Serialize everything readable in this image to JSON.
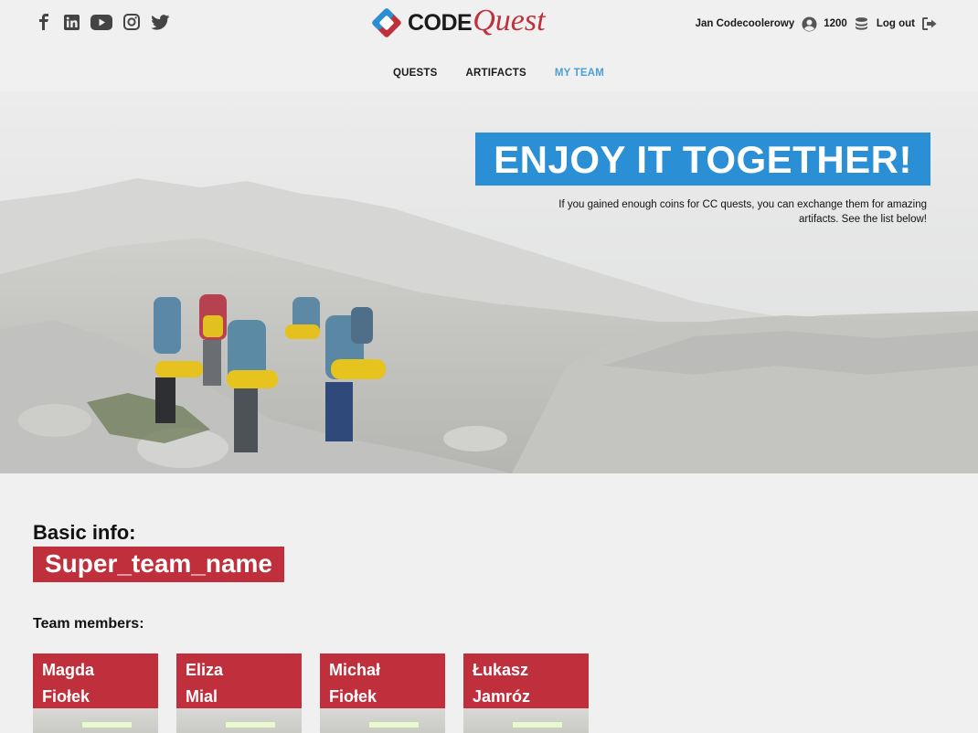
{
  "header": {
    "social": [
      "facebook-icon",
      "linkedin-icon",
      "youtube-icon",
      "instagram-icon",
      "twitter-icon"
    ],
    "logo": {
      "code": "CODE",
      "quest": "Quest"
    },
    "user": {
      "name": "Jan Codecoolerowy",
      "coins": "1200",
      "logout": "Log out"
    }
  },
  "nav": [
    {
      "label": "QUESTS",
      "active": false
    },
    {
      "label": "ARTIFACTS",
      "active": false
    },
    {
      "label": "MY TEAM",
      "active": true
    }
  ],
  "hero": {
    "title": "ENJOY IT TOGETHER!",
    "subtitle": "If you gained enough coins for CC quests, you can exchange them for amazing artifacts. See the list below!"
  },
  "content": {
    "basic_label": "Basic info:",
    "team_name": "Super_team_name",
    "members_label": "Team members:",
    "members": [
      {
        "first": "Magda",
        "last": "Fiołek"
      },
      {
        "first": "Eliza",
        "last": "Mial"
      },
      {
        "first": "Michał",
        "last": "Fiołek"
      },
      {
        "first": "Łukasz",
        "last": "Jamróz"
      }
    ]
  },
  "colors": {
    "accent_red": "#c0303c",
    "accent_blue": "#2a8fd4",
    "nav_active": "#4a9fd4",
    "background": "#f1f0f0"
  }
}
